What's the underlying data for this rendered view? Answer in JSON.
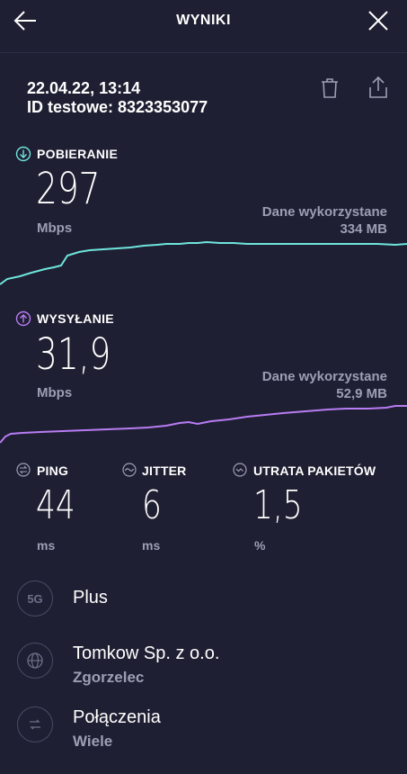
{
  "header": {
    "title": "WYNIKI"
  },
  "result": {
    "datetime": "22.04.22, 13:14",
    "test_id": "ID testowe: 8323353077"
  },
  "download": {
    "label": "POBIERANIE",
    "value": "297",
    "unit": "Mbps",
    "data_used_label": "Dane wykorzystane",
    "data_used_value": "334 MB",
    "color": "#6ee6dc"
  },
  "upload": {
    "label": "WYSYŁANIE",
    "value": "31,9",
    "unit": "Mbps",
    "data_used_label": "Dane wykorzystane",
    "data_used_value": "52,9 MB",
    "color": "#b87cf3"
  },
  "metrics": {
    "ping": {
      "label": "PING",
      "value": "44",
      "unit": "ms"
    },
    "jitter": {
      "label": "JITTER",
      "value": "6",
      "unit": "ms"
    },
    "packet_loss": {
      "label": "UTRATA PAKIETÓW",
      "value": "1,5",
      "unit": "%"
    }
  },
  "info": {
    "network": {
      "icon_text": "5G",
      "title": "Plus"
    },
    "provider": {
      "title": "Tomkow Sp. z o.o.",
      "subtitle": "Zgorzelec"
    },
    "connections": {
      "title": "Połączenia",
      "subtitle": "Wiele"
    }
  },
  "icons": {
    "back": "arrow-left-icon",
    "close": "close-icon",
    "delete": "trash-icon",
    "share": "share-icon",
    "download": "download-arrow-icon",
    "upload": "upload-arrow-icon",
    "ping": "ping-icon",
    "jitter": "jitter-icon",
    "packet_loss": "packet-loss-icon",
    "globe": "globe-icon",
    "connections": "connections-icon"
  }
}
